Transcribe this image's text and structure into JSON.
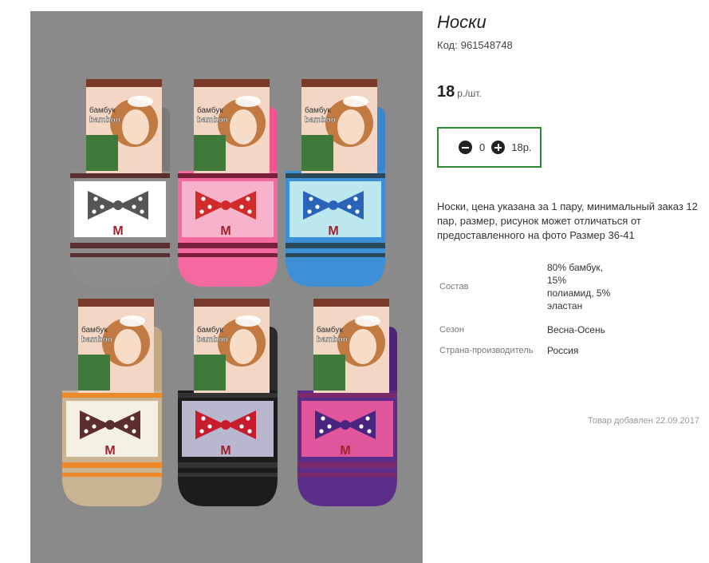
{
  "product": {
    "title": "Носки",
    "code_label": "Код:",
    "code_value": "961548748",
    "price_value": "18",
    "price_unit": "р./шт."
  },
  "quantity": {
    "value": "0",
    "sum": "18р.",
    "minus_icon": "minus-circle-icon",
    "plus_icon": "plus-circle-icon",
    "border_color": "#2f8a2f"
  },
  "description": "Носки, цена указана за 1 пару, минимальный заказ 12 пар, размер, рисунок может отличаться от предоставленного на фото Размер 36-41",
  "properties": [
    {
      "label": "Состав",
      "value": "80% бамбук, 15% полиамид, 5% эластан"
    },
    {
      "label": "Сезон",
      "value": "Весна-Осень"
    },
    {
      "label": "Страна-производитель",
      "value": "Россия"
    }
  ],
  "added_text": "Товар добавлен 22.09.2017",
  "photo": {
    "package_text_cyr": "бамбук",
    "package_text_lat": "bamboo",
    "sock_letter": "M"
  }
}
